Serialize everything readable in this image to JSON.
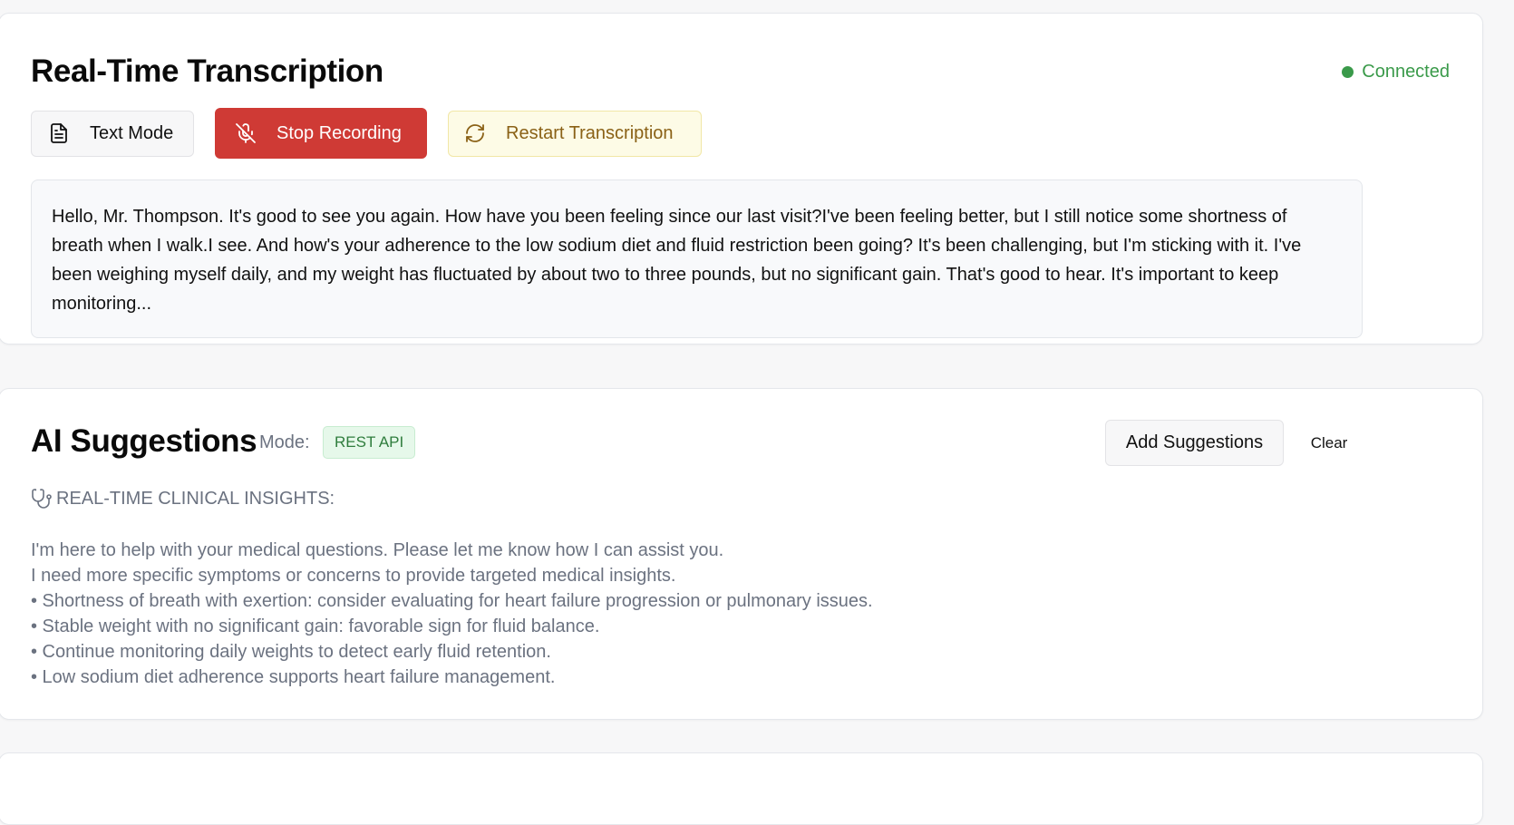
{
  "transcription": {
    "title": "Real-Time Transcription",
    "status": "Connected",
    "buttons": {
      "text_mode": "Text Mode",
      "stop_recording": "Stop Recording",
      "restart": "Restart Transcription"
    },
    "text": "Hello, Mr. Thompson. It's good to see you again. How have you been feeling since our last visit?I've been feeling better, but I still notice some shortness of breath when I walk.I see. And how's your adherence to the low sodium diet and fluid restriction been going? It's been challenging, but I'm sticking with it. I've been weighing myself daily, and my weight has fluctuated by about two to three pounds, but no significant gain. That's good to hear. It's important to keep monitoring..."
  },
  "ai": {
    "title": "AI Suggestions",
    "mode_label": "Mode:",
    "mode_value": "REST API",
    "add_button": "Add Suggestions",
    "clear_button": "Clear",
    "insights_header": "REAL-TIME CLINICAL INSIGHTS:",
    "lines": [
      "I'm here to help with your medical questions. Please let me know how I can assist you.",
      "I need more specific symptoms or concerns to provide targeted medical insights.",
      "• Shortness of breath with exertion: consider evaluating for heart failure progression or pulmonary issues.",
      "• Stable weight with no significant gain: favorable sign for fluid balance.",
      "• Continue monitoring daily weights to detect early fluid retention.",
      "• Low sodium diet adherence supports heart failure management."
    ]
  },
  "icons": {
    "text_mode": "document-icon",
    "stop": "mic-off-icon",
    "restart": "refresh-icon",
    "insights": "stethoscope-icon"
  },
  "colors": {
    "connected": "#3a9a4a",
    "stop_button": "#cf3a35",
    "restart_text": "#8a6116",
    "badge_text": "#2f7d3d"
  }
}
